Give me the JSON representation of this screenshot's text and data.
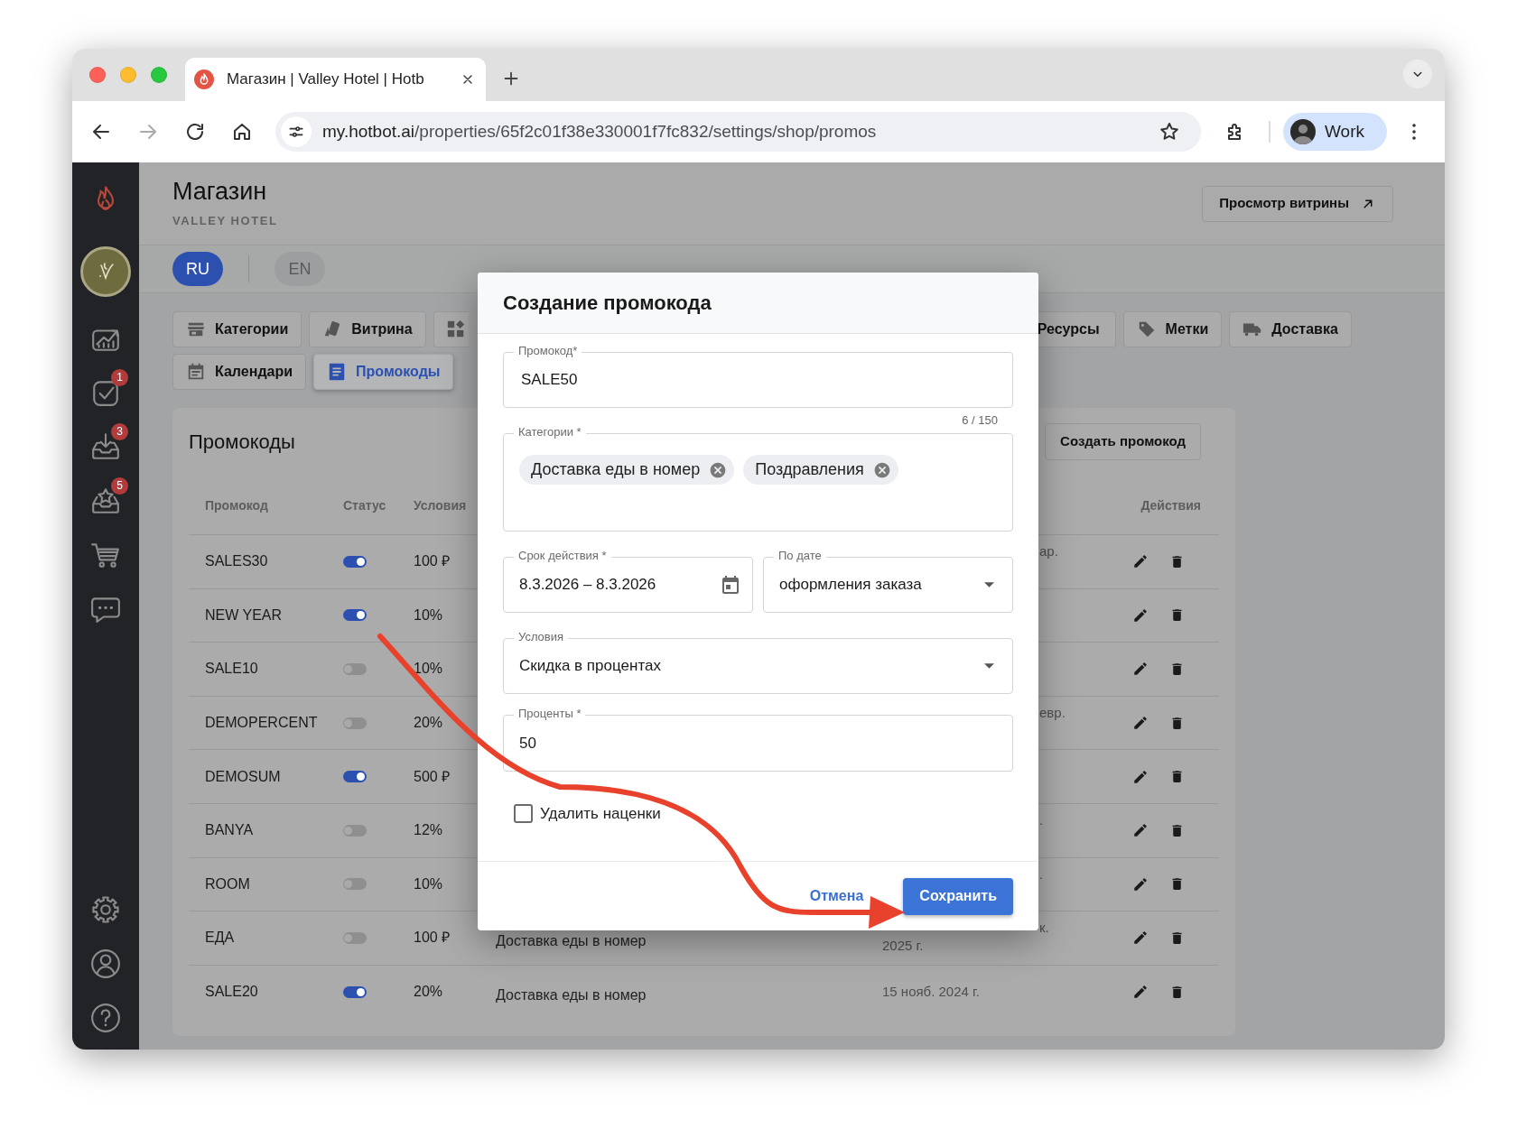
{
  "browser": {
    "tab_title": "Магазин | Valley Hotel | Hotb",
    "url_host": "my.hotbot.ai",
    "url_path": "/properties/65f2c01f38e330001f7fc832/settings/shop/promos",
    "profile": "Work"
  },
  "sidebar": {
    "items": [
      {
        "kind": "chart"
      },
      {
        "kind": "tasks",
        "badge": "1"
      },
      {
        "kind": "inbox",
        "badge": "3"
      },
      {
        "kind": "reviews",
        "badge": "5"
      },
      {
        "kind": "cart"
      },
      {
        "kind": "chat"
      }
    ],
    "bottom_items": [
      {
        "kind": "settings"
      },
      {
        "kind": "profile"
      },
      {
        "kind": "help"
      }
    ]
  },
  "header": {
    "title": "Магазин",
    "subtitle": "VALLEY HOTEL",
    "storefront_button": "Просмотр витрины"
  },
  "languages": [
    {
      "label": "RU",
      "selected": true
    },
    {
      "label": "EN",
      "selected": false
    }
  ],
  "tab_rows": [
    [
      {
        "kind": "store",
        "label": "Категории",
        "selected": false
      },
      {
        "kind": "cards",
        "label": "Витрина",
        "selected": false
      },
      {
        "kind": "widgets",
        "selected": false
      },
      {
        "kind": "resources",
        "label": "Ресурсы",
        "selected": false
      },
      {
        "kind": "tag",
        "label": "Метки",
        "selected": false
      },
      {
        "kind": "truck",
        "label": "Доставка",
        "selected": false
      }
    ],
    [
      {
        "kind": "calendar",
        "label": "Календари",
        "selected": false
      },
      {
        "kind": "list",
        "label": "Промокоды",
        "selected": true
      }
    ]
  ],
  "promos": {
    "title": "Промокоды",
    "create_button": "Создать промокод",
    "columns": {
      "code": "Промокод",
      "status": "Статус",
      "conditions": "Условия",
      "actions": "Действия"
    },
    "rows": [
      {
        "code": "SALES30",
        "active": true,
        "condition": "100 ₽",
        "date": [
          {
            "text": "ар.",
            "clipped": true
          }
        ]
      },
      {
        "code": "NEW YEAR",
        "active": true,
        "condition": "10%"
      },
      {
        "code": "SALE10",
        "active": false,
        "condition": "10%"
      },
      {
        "code": "DEMOPERCENT",
        "active": false,
        "condition": "20%",
        "date": [
          {
            "text": "евр.",
            "clipped": true
          }
        ]
      },
      {
        "code": "DEMOSUM",
        "active": true,
        "condition": "500 ₽"
      },
      {
        "code": "BANYA",
        "active": false,
        "condition": "12%",
        "date": [
          {
            "text": ".",
            "clipped": true
          }
        ]
      },
      {
        "code": "ROOM",
        "active": false,
        "condition": "10%",
        "date": [
          {
            "text": ".",
            "clipped": true
          }
        ]
      },
      {
        "code": "ЕДА",
        "active": false,
        "condition": "100 ₽",
        "category": "Доставка еды в номер",
        "date": [
          {
            "text": "к.",
            "clipped": true
          },
          {
            "text": "2025 г."
          }
        ]
      },
      {
        "code": "SALE20",
        "active": true,
        "condition": "20%",
        "category": "Доставка еды в номер",
        "date": [
          {
            "text": "15 нояб. 2024 г."
          }
        ]
      }
    ]
  },
  "dialog": {
    "title": "Создание промокода",
    "code_field": {
      "label": "Промокод*",
      "value": "SALE50",
      "counter": "6 / 150"
    },
    "categories_field": {
      "label": "Категории *",
      "chips": [
        "Доставка еды в номер",
        "Поздравления"
      ]
    },
    "period_field": {
      "label": "Срок действия *",
      "value": "8.3.2026 – 8.3.2026"
    },
    "date_basis_field": {
      "label": "По дате",
      "value": "оформления заказа"
    },
    "conditions_field": {
      "label": "Условия",
      "value": "Скидка в процентах"
    },
    "percent_field": {
      "label": "Проценты *",
      "value": "50"
    },
    "remove_markups": {
      "label": "Удалить наценки",
      "checked": false
    },
    "cancel_button": "Отмена",
    "save_button": "Сохранить"
  }
}
